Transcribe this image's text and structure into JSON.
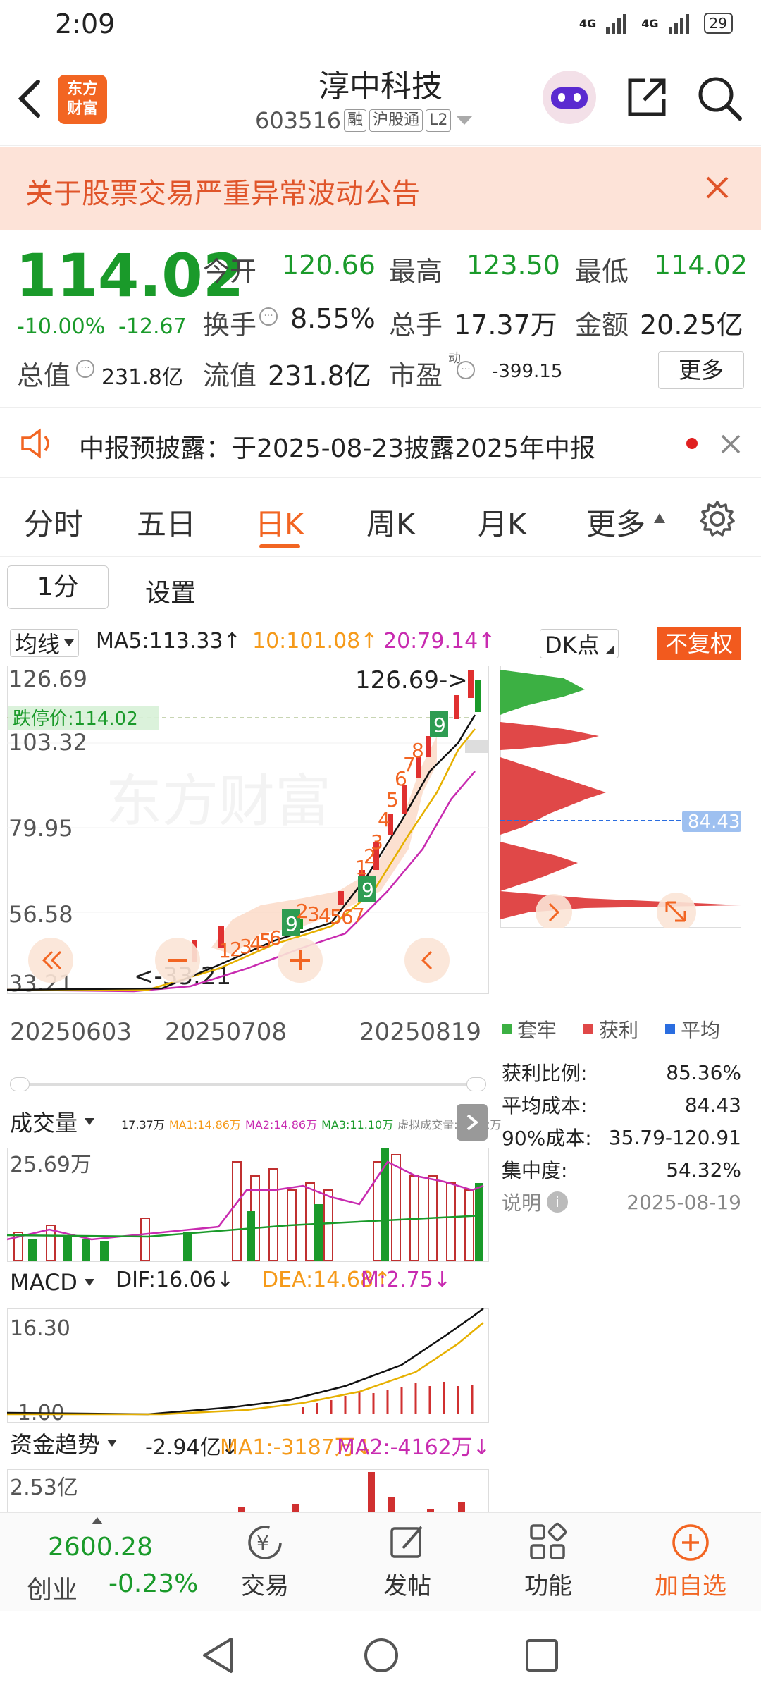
{
  "status": {
    "time": "2:09",
    "signal1": "4G",
    "signal2": "4G",
    "battery": "29"
  },
  "nav": {
    "logo_line1": "东方",
    "logo_line2": "财富",
    "title": "淳中科技",
    "code": "603516",
    "tags": [
      "融",
      "沪股通",
      "L2"
    ]
  },
  "notice": {
    "text": "关于股票交易严重异常波动公告"
  },
  "quote": {
    "price": "114.02",
    "change_pct": "-10.00%",
    "change": "-12.67",
    "open_label": "今开",
    "open": "120.66",
    "high_label": "最高",
    "high": "123.50",
    "low_label": "最低",
    "low": "114.02",
    "turnover_label": "换手",
    "turnover": "8.55%",
    "volume_label": "总手",
    "volume": "17.37万",
    "amount_label": "金额",
    "amount": "20.25亿",
    "mcap_label": "总值",
    "mcap": "231.8亿",
    "float_label": "流值",
    "float": "231.8亿",
    "pe_label": "市盈",
    "pe_sup": "动",
    "pe": "-399.15",
    "more": "更多"
  },
  "disclose": {
    "text": "中报预披露：于2025-08-23披露2025年中报"
  },
  "tabs": {
    "items": [
      "分时",
      "五日",
      "日K",
      "周K",
      "月K",
      "更多"
    ],
    "active": 2
  },
  "subtabs": {
    "period": "1分",
    "settings": "设置"
  },
  "ma_legend": {
    "select": "均线",
    "ma5": "MA5:113.33↑",
    "ma10": "10:101.08↑",
    "ma20": "20:79.14↑",
    "dk": "DK点",
    "adjust": "不复权"
  },
  "kchart": {
    "y_labels": [
      "126.69",
      "103.32",
      "79.95",
      "56.58",
      "33.21"
    ],
    "limit_label": "跌停价:114.02",
    "max_note": "126.69->",
    "min_note": "<-33.21",
    "watermark": "东方财富",
    "x_labels": [
      "20250603",
      "20250708",
      "20250819"
    ]
  },
  "chip": {
    "avg_cost_marker": "84.43",
    "legend": [
      "套牢",
      "获利",
      "平均"
    ],
    "colors": {
      "trapped": "#3cb043",
      "profit": "#e04848",
      "avg": "#2a6de0"
    },
    "stats": [
      {
        "label": "获利比例:",
        "value": "85.36%"
      },
      {
        "label": "平均成本:",
        "value": "84.43"
      },
      {
        "label": "90%成本:",
        "value": "35.79-120.91"
      },
      {
        "label": "集中度:",
        "value": "54.32%"
      }
    ],
    "note_label": "说明",
    "date": "2025-08-19"
  },
  "volume": {
    "select": "成交量",
    "legend": [
      "17.37万",
      "MA1:14.86万",
      "MA2:14.86万",
      "MA3:11.10万",
      "虚拟成交量:18.02万"
    ],
    "y_label": "25.69万"
  },
  "macd": {
    "select": "MACD",
    "dif": "DIF:16.06↓",
    "dea": "DEA:14.68↑",
    "m": "M:2.75↓",
    "y_top": "16.30",
    "y_bottom": "-1.00"
  },
  "fund": {
    "select": "资金趋势",
    "v": "-2.94亿↓",
    "ma1": "MA1:-3187万↓",
    "ma2": "MA2:-4162万↓",
    "y_top": "2.53亿"
  },
  "bottom": {
    "index_value": "2600.28",
    "index_name": "创业",
    "index_change": "-0.23%",
    "trade": "交易",
    "post": "发帖",
    "functions": "功能",
    "watch": "加自选"
  }
}
